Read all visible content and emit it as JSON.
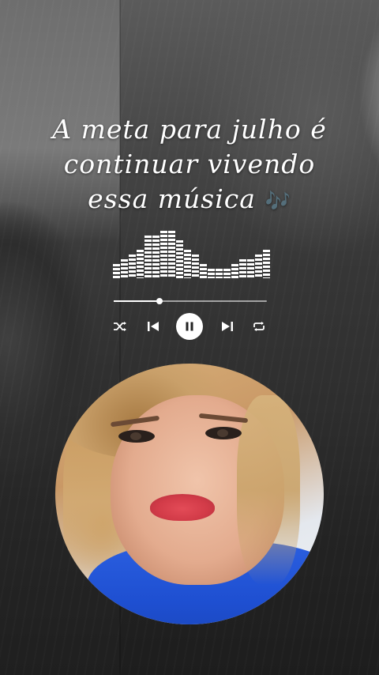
{
  "caption": {
    "line1": "A meta para julho é",
    "line2": "continuar vivendo",
    "line3": "essa música",
    "notes_glyph": "🎶"
  },
  "player": {
    "progress_fraction": 0.3,
    "equalizer_levels": [
      3,
      4,
      5,
      6,
      9,
      9,
      10,
      10,
      8,
      6,
      5,
      3,
      2,
      2,
      2,
      3,
      4,
      4,
      5,
      6
    ],
    "state": "playing",
    "controls": [
      "shuffle-icon",
      "previous-icon",
      "pause-icon",
      "next-icon",
      "repeat-icon"
    ]
  },
  "colors": {
    "text": "#ffffff",
    "notes": "#a9c9e8",
    "shirt": "#1e4fd1",
    "lips": "#d23b48"
  }
}
